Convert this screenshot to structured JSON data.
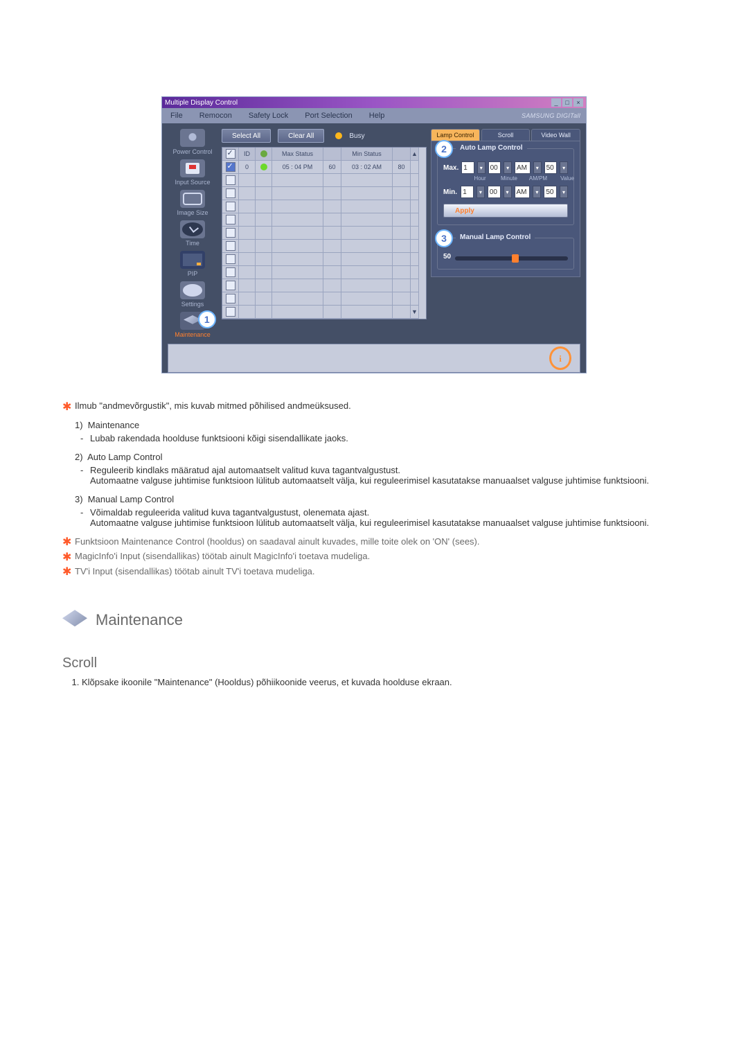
{
  "app": {
    "title": "Multiple Display Control",
    "brand": "SAMSUNG DIGITall",
    "menus": [
      "File",
      "Remocon",
      "Safety Lock",
      "Port Selection",
      "Help"
    ]
  },
  "nav": {
    "items": [
      {
        "label": "Power Control"
      },
      {
        "label": "Input Source"
      },
      {
        "label": "Image Size"
      },
      {
        "label": "Time"
      },
      {
        "label": "PIP"
      },
      {
        "label": "Settings"
      },
      {
        "label": "Maintenance"
      }
    ],
    "badge1": "1"
  },
  "toolbar": {
    "select_all": "Select All",
    "clear_all": "Clear All",
    "busy_label": "Busy"
  },
  "grid": {
    "cols": {
      "id": "ID",
      "max": "Max Status",
      "min": "Min Status"
    },
    "row0": {
      "id": "0",
      "max_time": "05 : 04 PM",
      "max_val": "60",
      "min_time": "03 : 02 AM",
      "min_val": "80"
    }
  },
  "tabs": {
    "lamp": "Lamp Control",
    "scroll": "Scroll",
    "video": "Video Wall"
  },
  "auto": {
    "title": "Auto Lamp Control",
    "badge": "2",
    "max_lbl": "Max.",
    "min_lbl": "Min.",
    "hour_hdr": "Hour",
    "minute_hdr": "Minute",
    "ampm_hdr": "AM/PM",
    "value_hdr": "Value",
    "hour": "1",
    "minute": "00",
    "ampm": "AM",
    "value": "50",
    "hour2": "1",
    "minute2": "00",
    "ampm2": "AM",
    "value2": "50",
    "apply": "Apply"
  },
  "manual": {
    "title": "Manual Lamp Control",
    "badge": "3",
    "value": "50"
  },
  "doc": {
    "intro": "Ilmub \"andmevõrgustik\", mis kuvab mitmed põhilised andmeüksused.",
    "i1_t": "Maintenance",
    "i1_d": "Lubab rakendada hoolduse funktsiooni kõigi sisendallikate jaoks.",
    "i2_t": "Auto Lamp Control",
    "i2_d1": "Reguleerib kindlaks määratud ajal automaatselt valitud kuva tagantvalgustust.",
    "i2_d2": "Automaatne valguse juhtimise funktsioon lülitub automaatselt välja, kui reguleerimisel kasutatakse manuaalset valguse juhtimise funktsiooni.",
    "i3_t": "Manual Lamp Control",
    "i3_d1": "Võimaldab reguleerida valitud kuva tagantvalgustust, olenemata ajast.",
    "i3_d2": "Automaatne valguse juhtimise funktsioon lülitub automaatselt välja, kui reguleerimisel kasutatakse manuaalset valguse juhtimise funktsiooni.",
    "n1": "Funktsioon Maintenance Control (hooldus) on saadaval ainult kuvades, mille toite olek on 'ON' (sees).",
    "n2": "MagicInfo'i Input (sisendallikas) töötab ainult MagicInfo'i toetava mudeliga.",
    "n3": "TV'i Input (sisendallikas) töötab ainult TV'i toetava mudeliga.",
    "sec": "Maintenance",
    "sub": "Scroll",
    "step1": "Klõpsake ikoonile \"Maintenance\" (Hooldus) põhiikoonide veerus, et kuvada hoolduse ekraan."
  }
}
